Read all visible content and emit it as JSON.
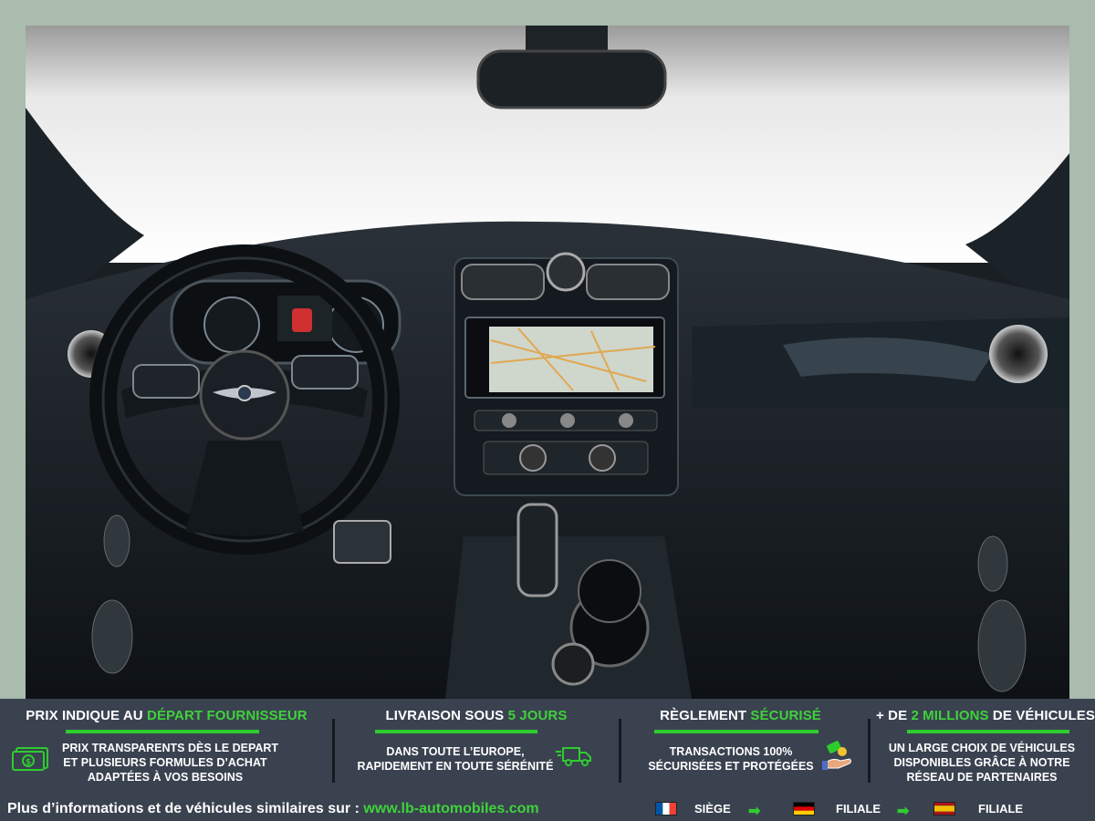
{
  "banner": {
    "col1": {
      "title_a": "PRIX INDIQUE AU ",
      "title_b": "DÉPART FOURNISSEUR",
      "line1": "PRIX TRANSPARENTS DÈS LE DEPART",
      "line2": "ET PLUSIEURS FORMULES D’ACHAT",
      "line3": "ADAPTÉES À VOS BESOINS",
      "icon": "money-icon"
    },
    "col2": {
      "title_a": "LIVRAISON SOUS ",
      "title_b": "5 JOURS",
      "line1": "DANS TOUTE L’EUROPE,",
      "line2": "RAPIDEMENT EN TOUTE SÉRÉNITÉ",
      "icon": "delivery-truck-icon"
    },
    "col3": {
      "title_a": "RÈGLEMENT ",
      "title_b": "SÉCURISÉ",
      "line1": "TRANSACTIONS 100%",
      "line2": "SÉCURISÉES ET PROTÉGÉES",
      "icon": "payment-hand-icon"
    },
    "col4": {
      "title_a": "+ DE ",
      "title_b": "2 MILLIONS",
      "title_c": " DE VÉHICULES",
      "line1": "UN LARGE CHOIX DE VÉHICULES",
      "line2": "DISPONIBLES GRÂCE À NOTRE",
      "line3": "RÉSEAU DE PARTENAIRES"
    }
  },
  "footer": {
    "info_text": "Plus d’informations et de véhicules similaires sur : ",
    "url": "www.lb-automobiles.com",
    "locations": [
      {
        "flag": "france-flag",
        "label": "SIÈGE"
      },
      {
        "flag": "germany-flag",
        "label": "FILIALE"
      },
      {
        "flag": "spain-flag",
        "label": "FILIALE"
      }
    ]
  },
  "colors": {
    "banner_bg": "#3a4250",
    "accent_green": "#3fd23a",
    "frame_bg": "#a9bcae"
  }
}
